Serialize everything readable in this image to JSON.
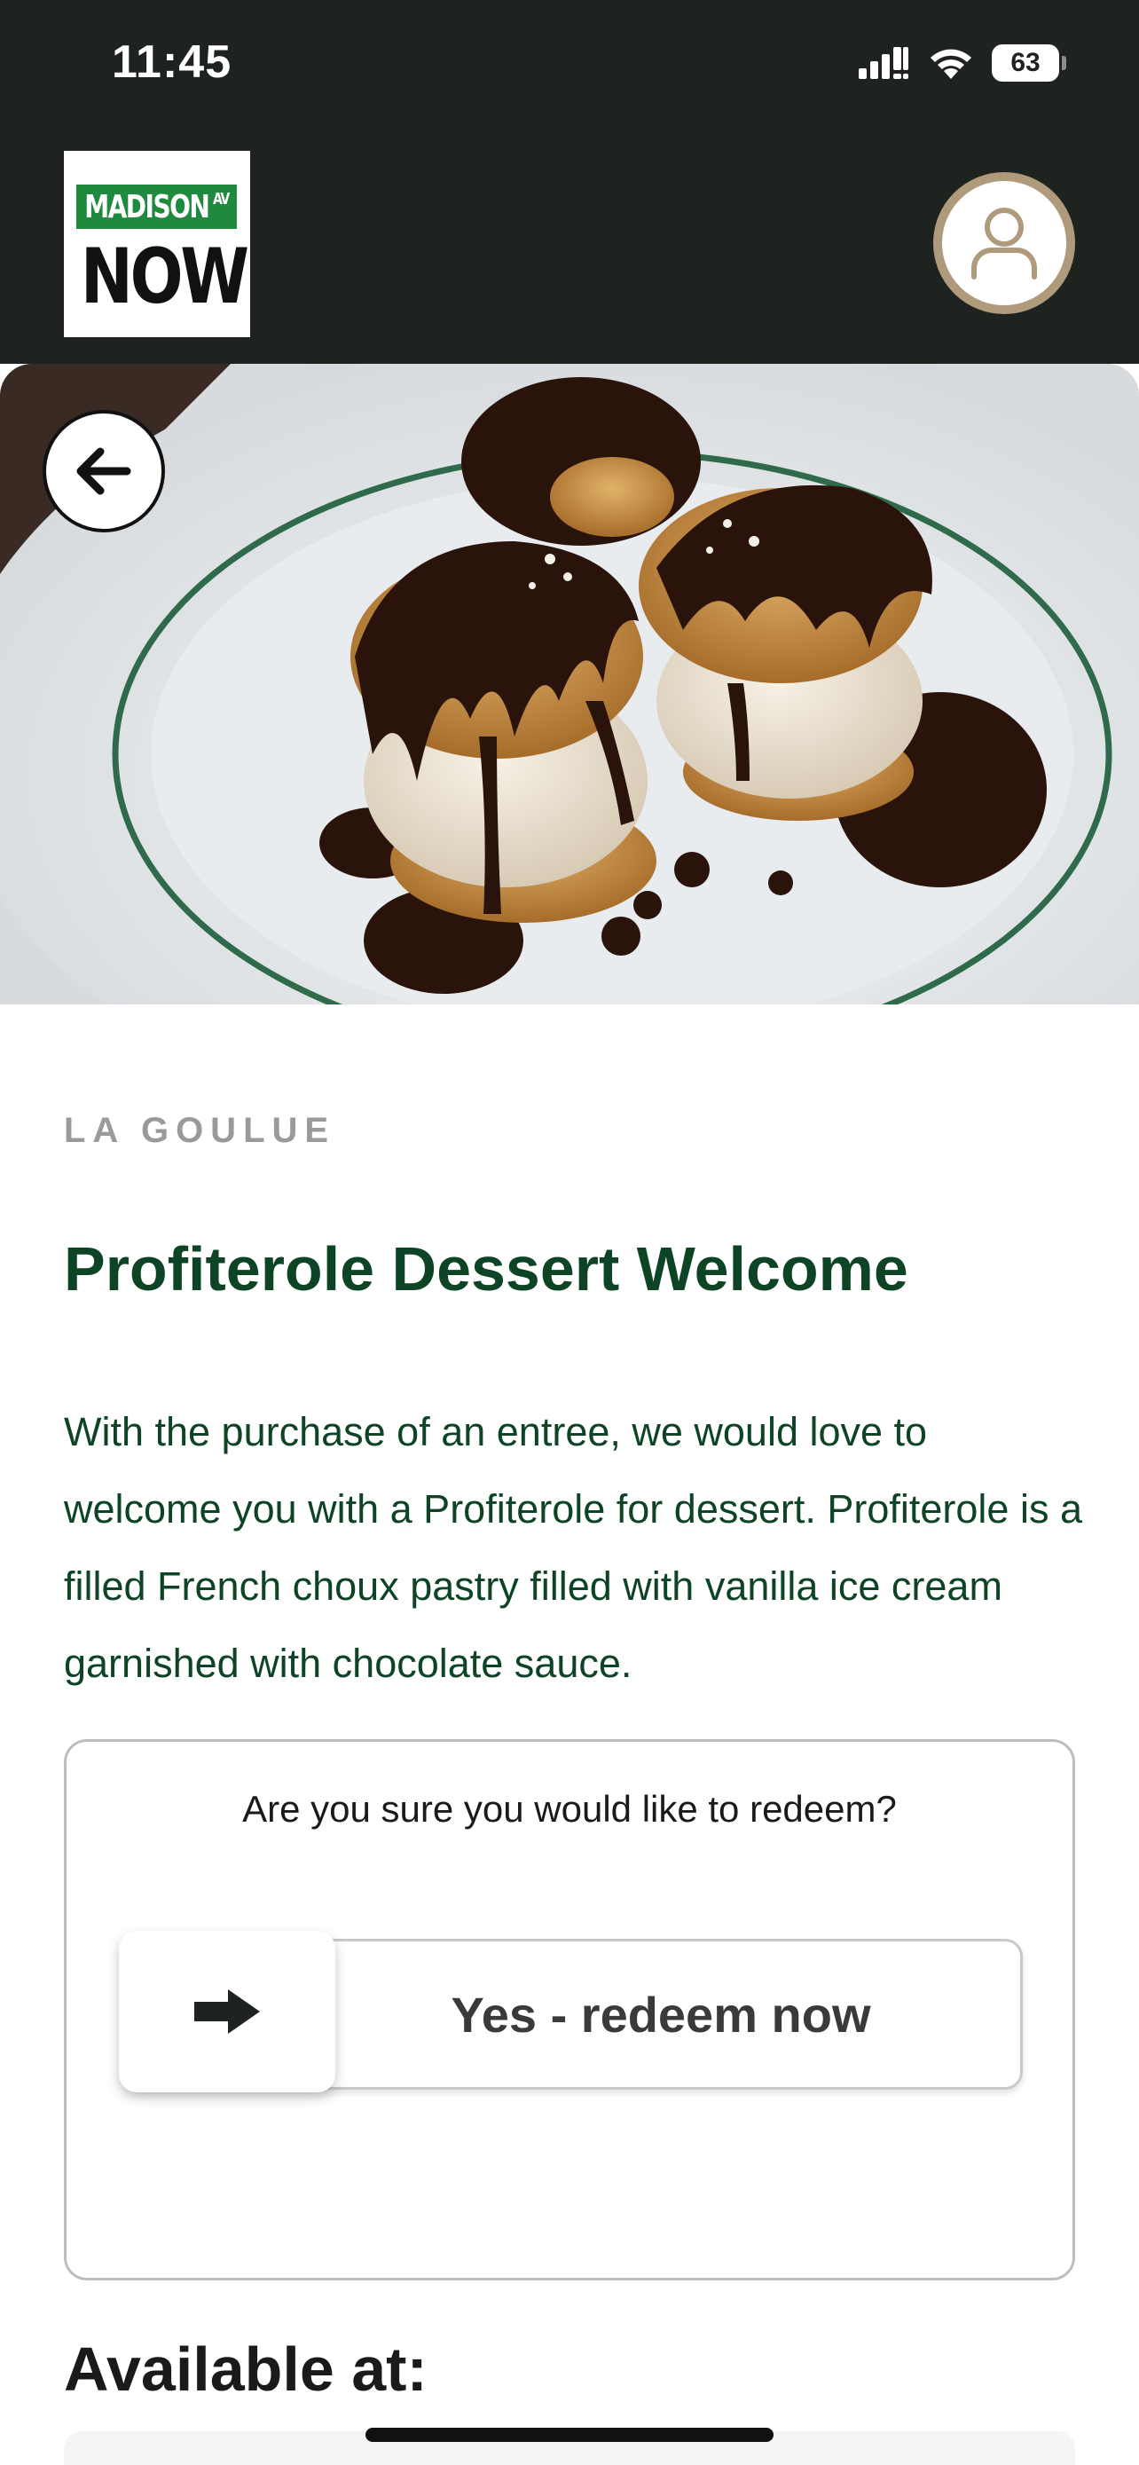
{
  "status_bar": {
    "time": "11:45",
    "battery": "63",
    "icons": [
      "signal-icon",
      "wifi-icon",
      "battery-icon"
    ]
  },
  "header": {
    "logo": {
      "sign_text": "MADISON",
      "sign_sub": "AV",
      "wordmark": "NOW"
    },
    "profile_icon": "person-icon"
  },
  "hero": {
    "back_icon": "arrow-left-icon"
  },
  "offer": {
    "merchant": "LA GOULUE",
    "title": "Profiterole Dessert Welcome",
    "description": "With the purchase of an entree, we would love to welcome you with a Profiterole for dessert. Profiterole is a filled French choux pastry filled with vanilla ice cream garnished with chocolate sauce."
  },
  "redeem": {
    "question": "Are you sure you would like to redeem?",
    "slider_label": "Yes - redeem now",
    "handle_icon": "arrow-right-icon"
  },
  "locations": {
    "heading": "Available at:"
  },
  "colors": {
    "header_bg": "#1f2320",
    "title_green": "#0e4426",
    "sign_green": "#1f8a3d",
    "profile_ring": "#b09a7c"
  }
}
